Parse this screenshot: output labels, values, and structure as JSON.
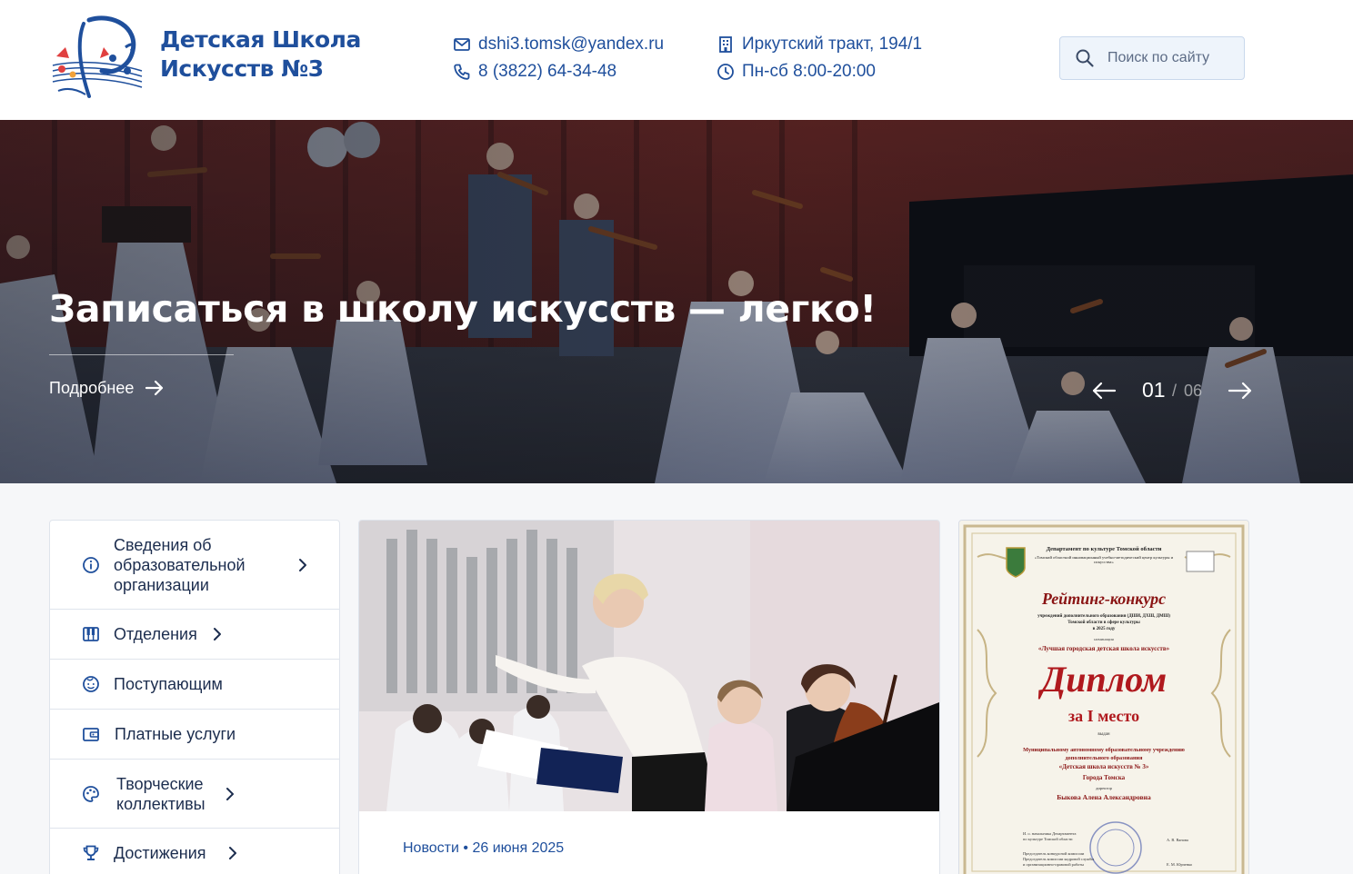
{
  "header": {
    "brand_line1": "Детская Школа",
    "brand_line2": "Искусств №3",
    "email": "dshi3.tomsk@yandex.ru",
    "phone": "8 (3822) 64-34-48",
    "address": "Иркутский тракт, 194/1",
    "hours": "Пн-сб 8:00-20:00",
    "search_placeholder": "Поиск по сайту",
    "brand_color": "#1f4f9c"
  },
  "hero": {
    "title": "Записаться в школу искусств — легко!",
    "more_label": "Подробнее",
    "slide_current": "01",
    "slide_separator": "/",
    "slide_total": "06"
  },
  "menu": {
    "items": [
      {
        "label_lines": [
          "Сведения об",
          "образовательной",
          "организации"
        ],
        "icon": "info-icon",
        "has_chevron": true
      },
      {
        "label": "Отделения",
        "icon": "piano-icon",
        "has_chevron": true
      },
      {
        "label": "Поступающим",
        "icon": "child-face-icon",
        "has_chevron": false
      },
      {
        "label": "Платные услуги",
        "icon": "wallet-icon",
        "has_chevron": false
      },
      {
        "label_lines": [
          "Творческие",
          "коллективы"
        ],
        "icon": "palette-icon",
        "has_chevron": true
      },
      {
        "label": "Достижения",
        "icon": "trophy-icon",
        "has_chevron": true
      }
    ]
  },
  "news": {
    "category": "Новости",
    "bullet": "•",
    "date": "26 июня 2025"
  },
  "diploma": {
    "line_dept": "Департамент по культуре Томской области",
    "line_center": "«Томский областной инновационный учебно-методический центр культуры и искусства»",
    "line_contest": "Рейтинг-конкурс",
    "line_contest_sub": "учреждений дополнительного образования (ДШИ, ДХШ, ДМШ)",
    "line_contest_sub2": "Томской области в сфере культуры",
    "line_year": "в 2025 году",
    "line_nom_label": "номинация",
    "line_nomination": "«Лучшая городская детская школа искусств»",
    "line_diploma": "Диплом",
    "line_place": "за I место",
    "line_given": "выдан",
    "line_org1": "Муниципальному автономному образовательному учреждению",
    "line_org2": "дополнительного образования",
    "line_org3": "«Детская школа искусств № 3»",
    "line_city": "Города Томска",
    "line_dir_label": "директор",
    "line_director": "Быкова Алена Александровна",
    "line_sign1": "И. о. начальника Департамента",
    "line_sign1b": "по культуре Томской области",
    "line_sign1_name": "А. В. Ванова",
    "line_sign2": "Председатель конкурсной комиссии",
    "line_sign2b": "Председатель комиссии кадровой службы",
    "line_sign2c": "и организационно-правовой работы",
    "line_sign2_name": "Е. М. Юрченко"
  }
}
